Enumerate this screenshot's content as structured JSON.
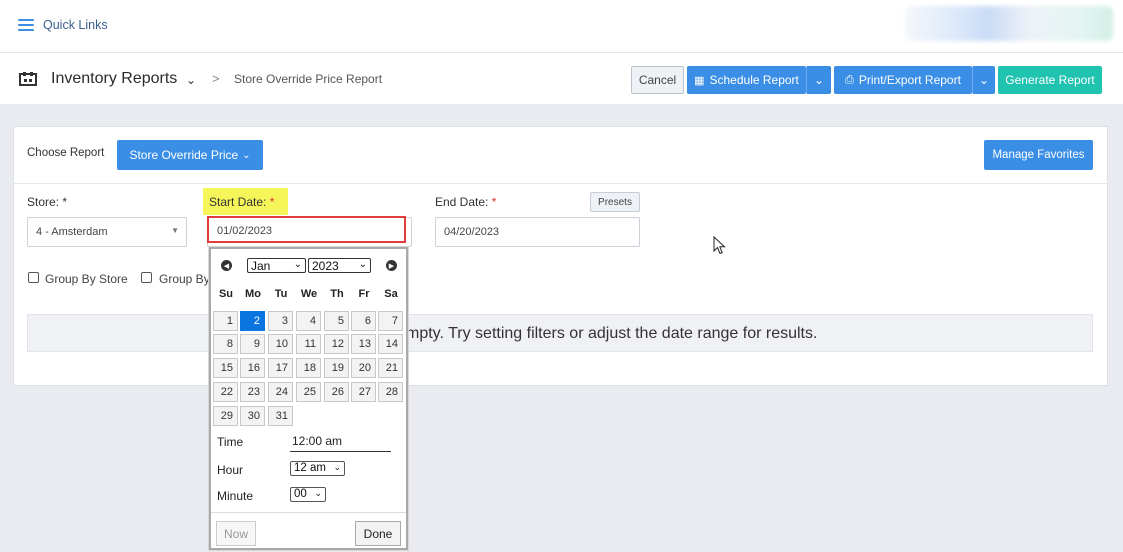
{
  "topbar": {
    "quick_links_label": "Quick Links"
  },
  "header": {
    "section_title": "Inventory Reports",
    "breadcrumb_separator": ">",
    "current_page": "Store Override Price Report"
  },
  "toolbar": {
    "cancel_label": "Cancel",
    "schedule_label": "Schedule Report",
    "print_label": "Print/Export Report",
    "generate_label": "Generate Report"
  },
  "report": {
    "choose_label": "Choose Report",
    "selected_report": "Store Override Price",
    "manage_favorites_label": "Manage Favorites"
  },
  "filters": {
    "store_label": "Store: *",
    "store_value": "4 - Amsterdam",
    "start_date_label": "Start Date:",
    "start_date_value": "01/02/2023",
    "end_date_label": "End Date:",
    "end_date_value": "04/20/2023",
    "required_mark": "*",
    "presets_label": "Presets",
    "group_by_store_label": "Group By Store",
    "group_by_partial_label": "Group By"
  },
  "results": {
    "empty_message": "mpty. Try setting filters or adjust the date range for results."
  },
  "datepicker": {
    "month": "Jan",
    "year": "2023",
    "weekdays": [
      "Su",
      "Mo",
      "Tu",
      "We",
      "Th",
      "Fr",
      "Sa"
    ],
    "weeks": [
      [
        "",
        "1",
        "2",
        "3",
        "4",
        "5",
        "6",
        "7"
      ],
      [
        "8",
        "9",
        "10",
        "11",
        "12",
        "13",
        "14"
      ],
      [
        "15",
        "16",
        "17",
        "18",
        "19",
        "20",
        "21"
      ],
      [
        "22",
        "23",
        "24",
        "25",
        "26",
        "27",
        "28"
      ],
      [
        "29",
        "30",
        "31"
      ]
    ],
    "selected_day": "2",
    "time_label": "Time",
    "time_value": "12:00 am",
    "hour_label": "Hour",
    "hour_value": "12 am",
    "minute_label": "Minute",
    "minute_value": "00",
    "now_label": "Now",
    "done_label": "Done"
  },
  "colors": {
    "primary": "#3a8ee6",
    "accent": "#20c2b0",
    "highlight": "#f5f55a",
    "error_border": "#e03c3c"
  }
}
